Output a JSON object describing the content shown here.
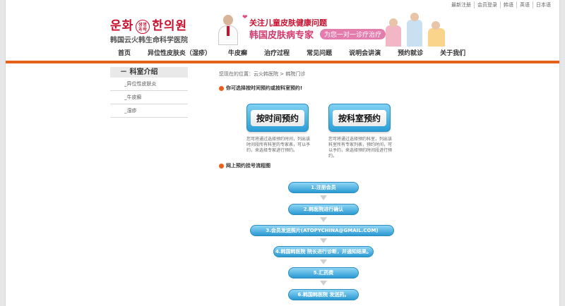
{
  "top_links": [
    "最新注册",
    "会员登录",
    "韩语",
    "英语",
    "日本语"
  ],
  "logo": {
    "korean_left": "운화",
    "korean_mid": "생명과학",
    "korean_right": "한의원",
    "chinese": "韩国云火韩生命科学医院"
  },
  "banner": {
    "line1": "关注儿童皮肤健康问题",
    "line2": "韩国皮肤病专家",
    "tag": "为您一对一诊疗治疗"
  },
  "nav": [
    "首页",
    "异位性皮肤炎（湿疹）",
    "牛皮癣",
    "治疗过程",
    "常见问题",
    "说明会讲演",
    "预约就诊",
    "关于我们"
  ],
  "sidebar": {
    "title": "－ 科室介绍",
    "items": [
      "_异位性皮肤炎",
      "_牛皮癣",
      "_湿疹"
    ]
  },
  "breadcrumb": "您现在的位置：云火韩医院 > 韩院门诊",
  "booking": {
    "note": "你可选择按时间预约或按科室预约!",
    "time_button": "按时间预约",
    "dept_button": "按科室预约",
    "time_desc": "您可将通过选择预约时间，列出该时间段所有科室的专家表，可以予约，来选择专家进行预约。",
    "dept_desc": "您可将通过选择预约科室，列出该科室所有专家列表，预约时间，可以予约，来选择预约时间段进行预约。"
  },
  "flow": {
    "title": "网上预约挂号流程图",
    "steps": [
      "1.注册会员",
      "2.韩医院进行确认",
      "3.会员发送照片(ATOPYCHINA@GMAIL.COM)",
      "4.韩国韩医院 院长进行诊断，并通知结果。",
      "5.汇药费",
      "6.韩国韩医院 发送药。"
    ]
  },
  "colors": {
    "accent_orange": "#e8611a",
    "brand_red": "#c8102e",
    "step_blue": "#2a99d2"
  }
}
